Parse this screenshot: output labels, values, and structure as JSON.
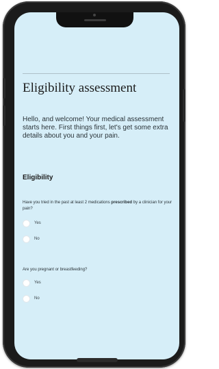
{
  "page": {
    "title": "Eligibility assessment",
    "intro": "Hello, and welcome! Your medical assessment starts here. First things first, let's get some extra details about you and your pain.",
    "section_title": "Eligibility"
  },
  "questions": [
    {
      "text_before": "Have you tried in the past at least 2 medications ",
      "text_bold": "prescribed",
      "text_after": " by a clinician for your pain?",
      "options": [
        "Yes",
        "No"
      ]
    },
    {
      "text_before": "Are you pregnant or breastfeeding?",
      "text_bold": "",
      "text_after": "",
      "options": [
        "Yes",
        "No"
      ]
    }
  ],
  "colors": {
    "screen_background": "#d6eef8",
    "phone_body": "#1b1b1b",
    "radio_fill": "#ffffff"
  }
}
